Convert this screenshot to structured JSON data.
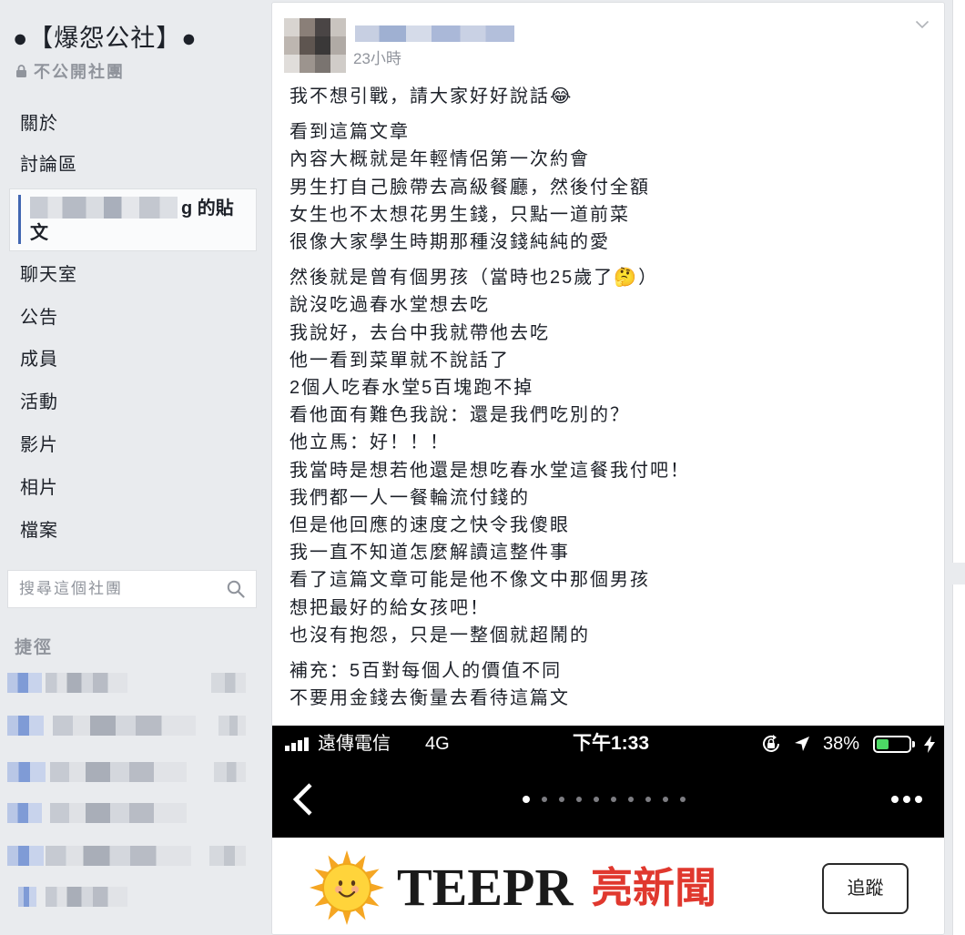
{
  "colors": {
    "page_bg": "#e9ebee",
    "text": "#1d2129",
    "muted": "#90949c",
    "accent": "#4267b2",
    "brand_red": "#e0382e",
    "battery_green": "#4cd964"
  },
  "sidebar": {
    "group_name": "●【爆怨公社】●",
    "privacy": {
      "icon": "lock-icon",
      "label": "不公開社團"
    },
    "nav": [
      {
        "label": "關於"
      },
      {
        "label": "討論區"
      },
      {
        "label": "g 的貼文",
        "selected": true
      },
      {
        "label": "聊天室"
      },
      {
        "label": "公告"
      },
      {
        "label": "成員"
      },
      {
        "label": "活動"
      },
      {
        "label": "影片"
      },
      {
        "label": "相片"
      },
      {
        "label": "檔案"
      }
    ],
    "search": {
      "placeholder": "搜尋這個社團",
      "icon": "search-icon"
    },
    "shortcuts_heading": "捷徑"
  },
  "post": {
    "timestamp": "23小時",
    "menu_icon": "chevron-down-icon",
    "paragraphs": [
      [
        "我不想引戰，請大家好好說話😂"
      ],
      [
        "看到這篇文章",
        "內容大概就是年輕情侶第一次約會",
        "男生打自己臉帶去高級餐廳，然後付全額",
        "女生也不太想花男生錢，只點一道前菜",
        "很像大家學生時期那種沒錢純純的愛"
      ],
      [
        "然後就是曾有個男孩（當時也25歲了🤔）",
        "說沒吃過春水堂想去吃",
        "我說好，去台中我就帶他去吃",
        "他一看到菜單就不說話了",
        "2個人吃春水堂5百塊跑不掉",
        "看他面有難色我說：還是我們吃別的？",
        "他立馬：好！！！",
        "我當時是想若他還是想吃春水堂這餐我付吧！",
        "我們都一人一餐輪流付錢的",
        "但是他回應的速度之快令我傻眼",
        "我一直不知道怎麼解讀這整件事",
        "看了這篇文章可能是他不像文中那個男孩",
        "想把最好的給女孩吧！",
        "也沒有抱怨，只是一整個就超鬧的"
      ],
      [
        "補充：5百對每個人的價值不同",
        "不要用金錢去衡量去看待這篇文"
      ]
    ],
    "image": {
      "status_bar": {
        "signal_icon": "signal-bars-icon",
        "carrier": "遠傳電信",
        "network": "4G",
        "time": "下午1:33",
        "orientation_icon": "orientation-lock-icon",
        "location_icon": "location-arrow-icon",
        "battery_text": "38%",
        "battery_level": 0.38,
        "charging_icon": "charging-bolt-icon"
      },
      "nav_bar": {
        "back_icon": "chevron-left-icon",
        "pagination": {
          "total": 10,
          "current": 1
        },
        "more_icon": "more-horizontal-icon"
      },
      "brand": {
        "logo_icon": "sun-logo-icon",
        "latin": "TEEPR",
        "cjk": "亮新聞",
        "follow_label": "追蹤"
      }
    }
  }
}
